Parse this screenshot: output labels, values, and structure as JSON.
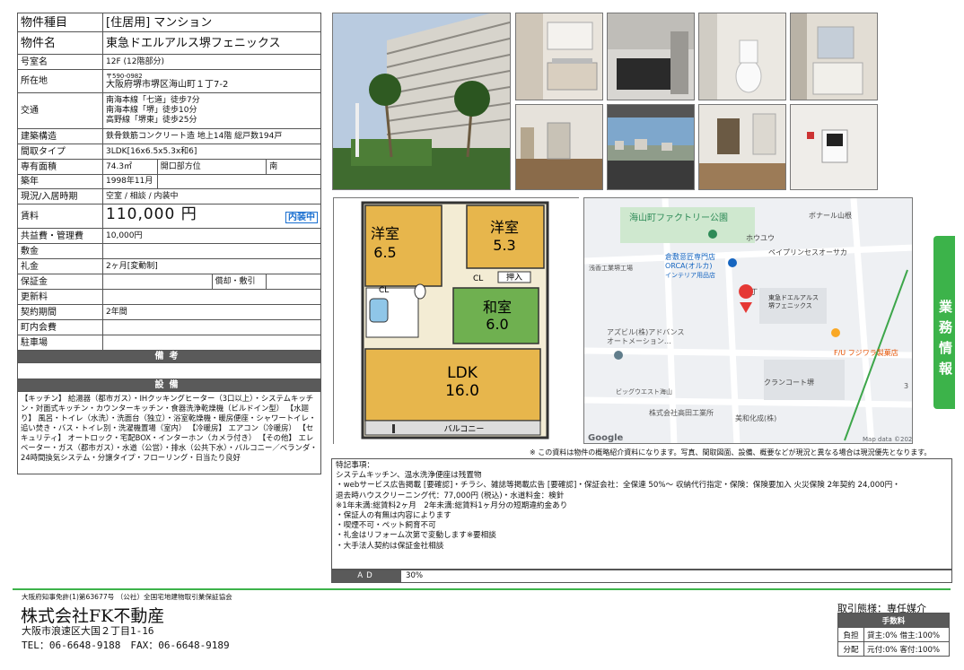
{
  "spec": {
    "type_label": "物件種目",
    "type_value": "[住居用] マンション",
    "name_label": "物件名",
    "name_value": "東急ドエルアルス堺フェニックス",
    "room_label": "号室名",
    "room_value": "12F (12階部分)",
    "addr_label": "所在地",
    "addr_zip": "〒590-0982",
    "addr_value": "大阪府堺市堺区海山町１丁7-2",
    "traffic_label": "交通",
    "traffic_1": "南海本線「七道」徒歩7分",
    "traffic_2": "南海本線「堺」徒歩10分",
    "traffic_3": "高野線「堺東」徒歩25分",
    "structure_label": "建築構造",
    "structure_value": "鉄骨鉄筋コンクリート造 地上14階 総戸数194戸",
    "layout_label": "間取タイプ",
    "layout_value": "3LDK[16x6.5x5.3x和6]",
    "area_label": "専有面積",
    "area_value": "74.3㎡",
    "direction_label": "開口部方位",
    "direction_value": "南",
    "built_label": "築年",
    "built_value": "1998年11月",
    "status_label": "現況/入居時期",
    "status_value": "空室 / 相談 / 内装中",
    "rent_label": "賃料",
    "rent_value": "110,000 円",
    "rent_badge": "内装中",
    "common_label": "共益費・管理費",
    "common_value": "10,000円",
    "deposit_label": "敷金",
    "deposit_value": "",
    "key_label": "礼金",
    "key_value": "2ヶ月[変動制]",
    "guarantee_label": "保証金",
    "guarantee_value": "",
    "amort_label": "償却・敷引",
    "amort_value": "",
    "renew_label": "更新料",
    "renew_value": "",
    "contract_label": "契約期間",
    "contract_value": "2年間",
    "town_label": "町内会費",
    "town_value": "",
    "parking_label": "駐車場",
    "parking_value": "",
    "biko_header": "備考",
    "biko_value": "",
    "equip_header": "設備",
    "equip_text": "【キッチン】 給湯器（都市ガス）・IHクッキングヒーター（3口以上）・システムキッチン・対面式キッチン・カウンターキッチン・食器洗浄乾燥機（ビルドイン型） 【水廻り】 風呂・トイレ（水洗）・洗面台（独立）・浴室乾燥機・暖房便座・シャワートイレ・追い焚き・バス・トイレ別・洗濯機置場（室内） 【冷暖房】 エアコン（冷暖房） 【セキュリティ】 オートロック・宅配BOX・インターホン（カメラ付き） 【その他】 エレベーター・ガス（都市ガス）・水道（公営）・排水（公共下水）・バルコニー／ベランダ・24時間換気システム・分譲タイプ・フローリング・日当たり良好"
  },
  "plan": {
    "room1": "洋室",
    "room1_size": "6.5",
    "room2": "洋室",
    "room2_size": "5.3",
    "room3": "和室",
    "room3_size": "6.0",
    "ldk": "LDK",
    "ldk_size": "16.0",
    "cl": "CL",
    "oshiire": "押入",
    "balcony": "バルコニー"
  },
  "map": {
    "park": "海山町ファクトリー公園",
    "bonarl": "ボナール山根",
    "houyou": "ホウユウ",
    "peip": "ペイプリンセスオーサカ",
    "kurashiki": "倉敷意匠専門店",
    "orca": "ORCA(オルカ)",
    "interior": "インテリア用品店",
    "asaka": "浅香工業堺工場",
    "chome": "1丁",
    "pin_label_1": "東急ドエルアルス",
    "pin_label_2": "堺フェニックス",
    "azubil_1": "アズビル(株)アドバンス",
    "azubil_2": "オートメーション…",
    "fujiwara": "F/U フジワラ製菓店",
    "clancourt": "クランコート堺",
    "big": "ビッグウエスト海山",
    "takada": "株式会社高田工業所",
    "mika": "美和化成(株)",
    "num3": "3",
    "google": "Google",
    "mapdata": "Map data ©2023"
  },
  "side_tab": "業務情報",
  "note_top": "※ この資料は物件の概略紹介資料になります。写真、間取図面、設備、概要などが現況と異なる場合は現況優先となります。",
  "remarks": {
    "title": "特記事項：",
    "line1": "システムキッチン、温水洗浄便座は残置物",
    "line2": "・webサービス広告掲載 [要確認]・チラシ、雑誌等掲載広告 [要確認]・保証会社：全保連 50%〜 収納代行指定・保険：保険要加入 火災保険 2年契約 24,000円・",
    "line3": "退去時ハウスクリーニング代：77,000円 (税込)・水道料金：検針",
    "line4": "※1年未満:総賃料2ヶ月　2年未満:総賃料1ヶ月分の短期違約金あり",
    "line5": "・保証人の有無は内容によります",
    "line6": "・喫煙不可・ペット飼育不可",
    "line7": "・礼金はリフォーム次第で変動します※要相談",
    "line8": "・大手法人契約は保証金社相談"
  },
  "ad": {
    "label": "AD",
    "value": "30%"
  },
  "company": {
    "license": "大阪府知事免許(1)第63677号 （公社）全国宅地建物取引業保証協会",
    "name": "株式会社FK不動産",
    "address": "大阪市浪速区大国２丁目1-16",
    "tel": "TEL：06-6648-9188　FAX：06-6648-9189"
  },
  "fee": {
    "trade": "取引態様：専任媒介",
    "header": "手数料",
    "burden_label": "負担",
    "burden_value": "貸主:0% 借主:100%",
    "split_label": "分配",
    "split_value": "元付:0% 客付:100%"
  },
  "colors": {
    "accent_green": "#3cb34a",
    "bar_gray": "#5a5a5a",
    "badge_blue": "#1a6fd0",
    "map_pin": "#e53935"
  }
}
